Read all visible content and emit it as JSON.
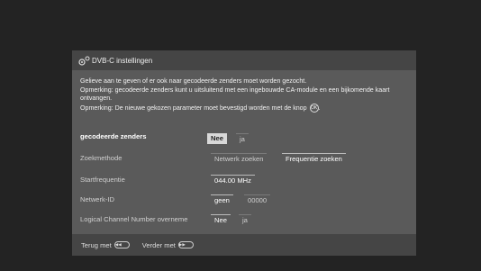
{
  "dialog": {
    "icon": "gear-icon",
    "title": "DVB-C instellingen"
  },
  "info": {
    "line1": "Gelieve aan te geven of er ook naar gecodeerde zenders moet worden gezocht.",
    "line2": "Opmerking: gecodeerde zenders kunt u uitsluitend met een ingebouwde CA-module en een bijkomende kaart ontvangen.",
    "line3": "Opmerking: De nieuwe gekozen parameter moet bevestigd worden met de knop",
    "ok_icon_label": "OK"
  },
  "settings": {
    "gecodeerde": {
      "label": "gecodeerde zenders",
      "options": [
        "Nee",
        "ja"
      ],
      "selected": "Nee"
    },
    "zoekmethode": {
      "label": "Zoekmethode",
      "options": [
        "Netwerk zoeken",
        "Frequentie zoeken"
      ],
      "selected": "Frequentie zoeken"
    },
    "startfrequentie": {
      "label": "Startfrequentie",
      "value": "044.00 MHz"
    },
    "netwerk_id": {
      "label": "Netwerk-ID",
      "options": [
        "geen",
        "00000"
      ],
      "selected": "geen"
    },
    "lcn": {
      "label": "Logical Channel Number overneme",
      "options": [
        "Nee",
        "ja"
      ],
      "selected": "Nee"
    }
  },
  "footer": {
    "back_label": "Terug met",
    "back_icon": "rewind-button-icon",
    "forward_label": "Verder met",
    "forward_icon": "forward-button-icon"
  }
}
